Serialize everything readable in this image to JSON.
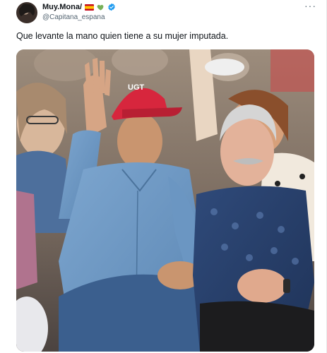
{
  "tweet": {
    "display_name": "Muy.Mona/",
    "handle": "@Capitana_espana",
    "more_label": "···",
    "text": "Que levante la mano quien tiene a su mujer imputada.",
    "cap_text": "UGT"
  },
  "icons": {
    "flag": "spain-flag-icon",
    "heart": "green-heart-icon",
    "verified": "verified-badge-icon",
    "more": "more-options-icon"
  },
  "colors": {
    "verified": "#1d9bf0",
    "heart": "#78b159",
    "handle": "#536471",
    "cap": "#d7263d"
  }
}
